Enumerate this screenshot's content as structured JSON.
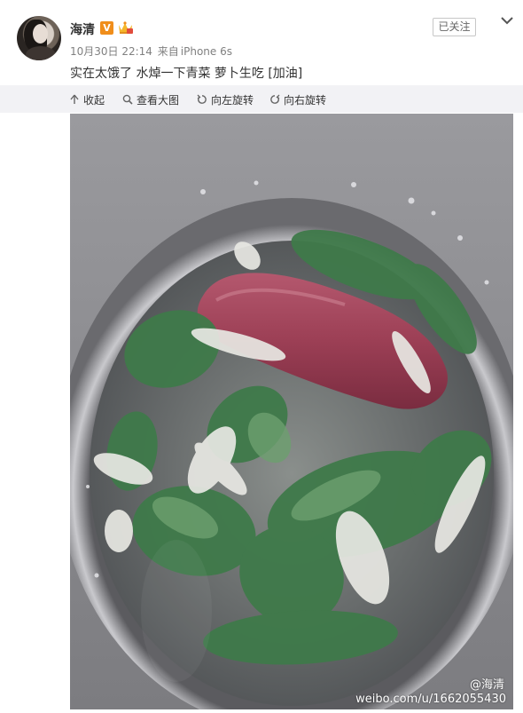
{
  "user": {
    "name": "海清",
    "verified_badge": "V"
  },
  "post": {
    "date": "10月30日 22:14",
    "source_prefix": "来自",
    "device": "iPhone 6s",
    "text": "实在太饿了 水焯一下青菜 萝卜生吃  [加油]"
  },
  "actions": {
    "follow_label": "已关注"
  },
  "toolbar": {
    "collapse": "收起",
    "view_large": "查看大图",
    "rotate_left": "向左旋转",
    "rotate_right": "向右旋转"
  },
  "image": {
    "watermark_user": "@海清",
    "watermark_url": "weibo.com/u/1662055430"
  },
  "colors": {
    "vip": "#f08e1b",
    "toolbar_bg": "#f2f2f5",
    "text_gray": "#808080"
  }
}
